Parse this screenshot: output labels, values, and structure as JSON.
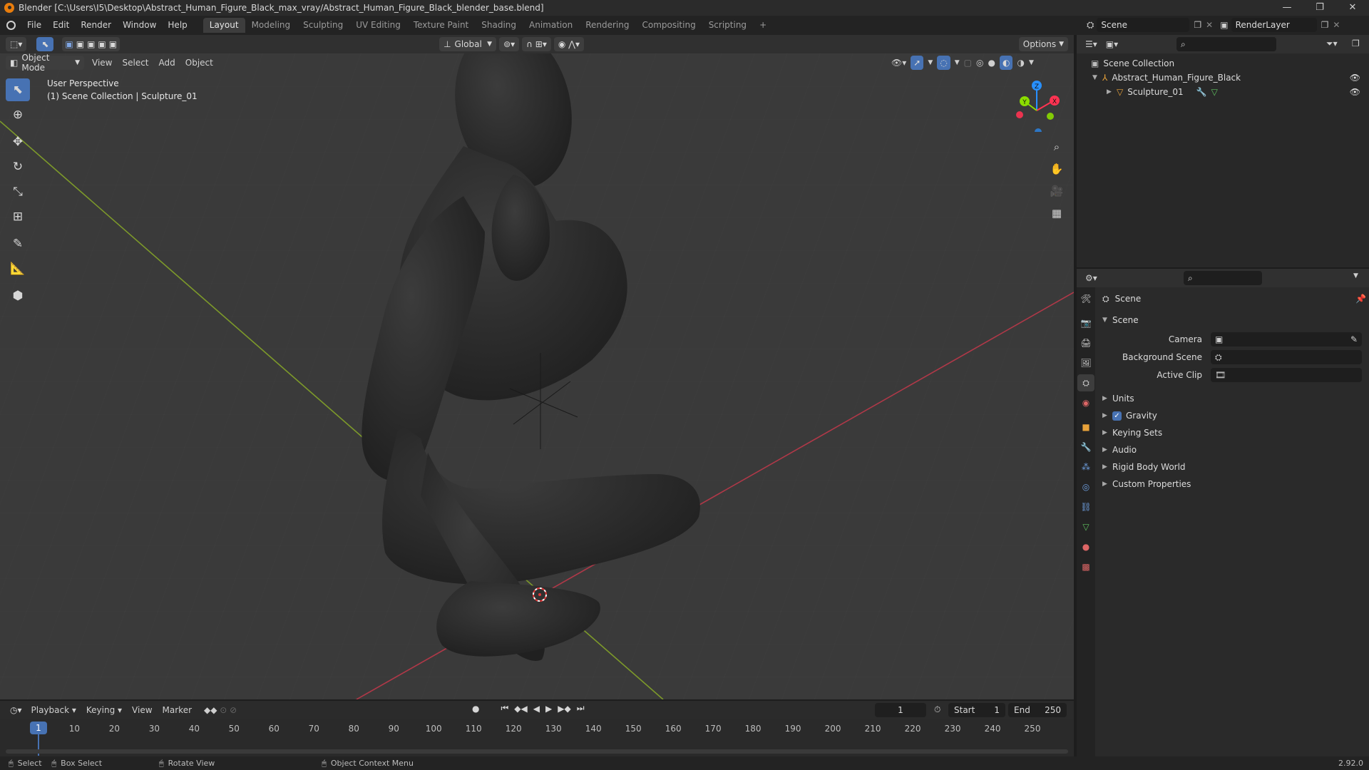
{
  "window": {
    "title": "Blender [C:\\Users\\I5\\Desktop\\Abstract_Human_Figure_Black_max_vray/Abstract_Human_Figure_Black_blender_base.blend]",
    "minimize": "—",
    "maximize": "❐",
    "close": "✕"
  },
  "menus": [
    "File",
    "Edit",
    "Render",
    "Window",
    "Help"
  ],
  "workspaces": [
    "Layout",
    "Modeling",
    "Sculpting",
    "UV Editing",
    "Texture Paint",
    "Shading",
    "Animation",
    "Rendering",
    "Compositing",
    "Scripting"
  ],
  "workspace_add": "+",
  "active_workspace": "Layout",
  "scene_selector": {
    "scene": "Scene",
    "view_layer": "RenderLayer"
  },
  "viewport_header": {
    "transform_orientation": "Global",
    "options": "Options"
  },
  "viewport_menu": {
    "mode": "Object Mode",
    "items": [
      "View",
      "Select",
      "Add",
      "Object"
    ]
  },
  "viewport_info": {
    "line1": "User Perspective",
    "line2": "(1) Scene Collection | Sculpture_01"
  },
  "gizmo": {
    "x": "X",
    "y": "Y",
    "z": "Z"
  },
  "outliner": {
    "root": "Scene Collection",
    "items": [
      {
        "label": "Abstract_Human_Figure_Black"
      },
      {
        "label": "Sculpture_01"
      }
    ]
  },
  "properties": {
    "context": "Scene",
    "panel_title": "Scene",
    "fields": [
      {
        "label": "Camera"
      },
      {
        "label": "Background Scene"
      },
      {
        "label": "Active Clip"
      }
    ],
    "subpanels": [
      "Units",
      "Gravity",
      "Keying Sets",
      "Audio",
      "Rigid Body World",
      "Custom Properties"
    ],
    "gravity_checked": true
  },
  "timeline": {
    "menus": [
      "Playback",
      "Keying",
      "View",
      "Marker"
    ],
    "current_frame": "1",
    "start_label": "Start",
    "start": "1",
    "end_label": "End",
    "end": "250",
    "ticks": [
      "1",
      "10",
      "20",
      "30",
      "40",
      "50",
      "60",
      "70",
      "80",
      "90",
      "100",
      "110",
      "120",
      "130",
      "140",
      "150",
      "160",
      "170",
      "180",
      "190",
      "200",
      "210",
      "220",
      "230",
      "240",
      "250"
    ],
    "tick_values": [
      1,
      10,
      20,
      30,
      40,
      50,
      60,
      70,
      80,
      90,
      100,
      110,
      120,
      130,
      140,
      150,
      160,
      170,
      180,
      190,
      200,
      210,
      220,
      230,
      240,
      250
    ],
    "playhead": 1
  },
  "statusbar": {
    "select": "Select",
    "box_select": "Box Select",
    "rotate_view": "Rotate View",
    "context_menu": "Object Context Menu",
    "version": "2.92.0"
  },
  "colors": {
    "accent": "#4772b3",
    "x_axis": "#ff3352",
    "y_axis": "#8bdc00",
    "z_axis": "#2890ff",
    "orange": "#e87d0d"
  }
}
